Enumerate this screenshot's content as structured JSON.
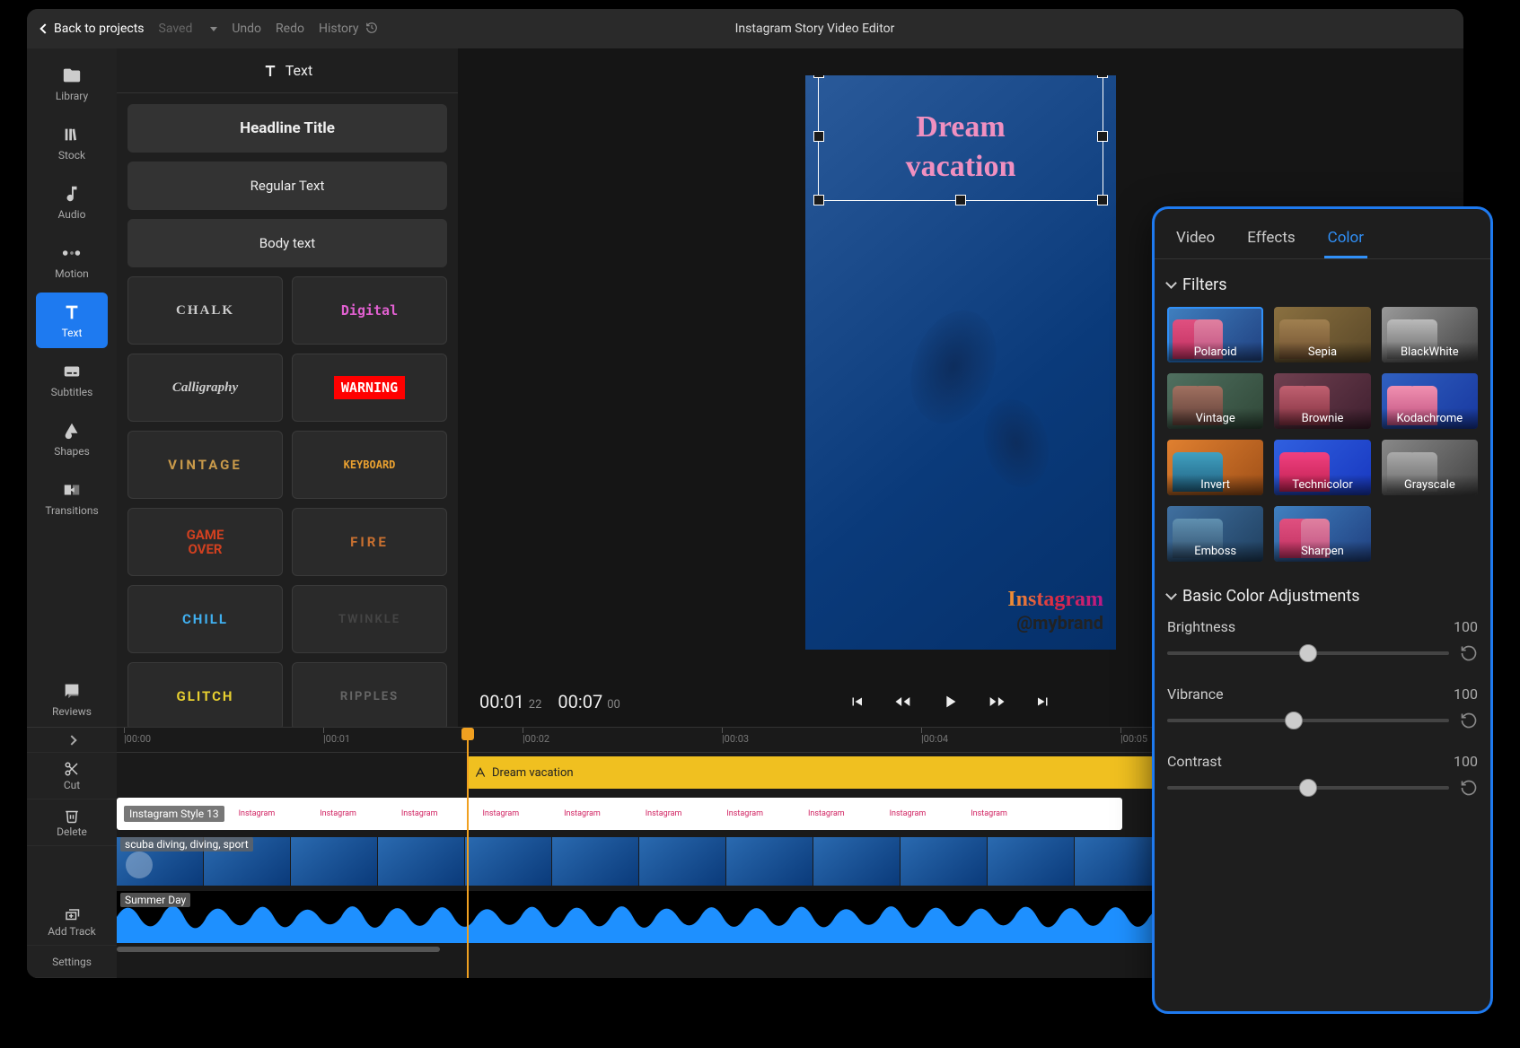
{
  "topbar": {
    "back": "Back to projects",
    "saved": "Saved",
    "undo": "Undo",
    "redo": "Redo",
    "history": "History",
    "app_title": "Instagram Story Video Editor"
  },
  "rail": {
    "library": "Library",
    "stock": "Stock",
    "audio": "Audio",
    "motion": "Motion",
    "text": "Text",
    "subtitles": "Subtitles",
    "shapes": "Shapes",
    "transitions": "Transitions",
    "reviews": "Reviews"
  },
  "text_panel": {
    "title": "Text",
    "headline": "Headline Title",
    "regular": "Regular Text",
    "body": "Body text",
    "styles": [
      "CHALK",
      "Digital",
      "Calligraphy",
      "WARNING",
      "VINTAGE",
      "KEYBOARD",
      "GAME OVER",
      "FIRE",
      "CHILL",
      "TWINKLE",
      "GLITCH",
      "RIPPLES"
    ]
  },
  "preview": {
    "text_line1": "Dream",
    "text_line2": "vacation",
    "brand": "Instagram",
    "handle": "@mybrand"
  },
  "playback": {
    "current": "00:01",
    "current_frames": "22",
    "total": "00:07",
    "total_frames": "00"
  },
  "timeline": {
    "tools": {
      "cut": "Cut",
      "delete": "Delete",
      "add_track": "Add Track",
      "settings": "Settings"
    },
    "ruler": [
      "|00:00",
      "|00:01",
      "|00:02",
      "|00:03",
      "|00:04",
      "|00:05"
    ],
    "text_clip": "Dream vacation",
    "style_clip": "Instagram Style 13",
    "video_clip": "scuba diving, diving, sport",
    "audio_clip": "Summer Day"
  },
  "props": {
    "tabs": {
      "video": "Video",
      "effects": "Effects",
      "color": "Color"
    },
    "filters_title": "Filters",
    "filters": [
      "Polaroid",
      "Sepia",
      "BlackWhite",
      "Vintage",
      "Brownie",
      "Kodachrome",
      "Invert",
      "Technicolor",
      "Grayscale",
      "Emboss",
      "Sharpen"
    ],
    "adjust_title": "Basic Color Adjustments",
    "brightness": {
      "label": "Brightness",
      "value": "100"
    },
    "vibrance": {
      "label": "Vibrance",
      "value": "100"
    },
    "contrast": {
      "label": "Contrast",
      "value": "100"
    }
  }
}
